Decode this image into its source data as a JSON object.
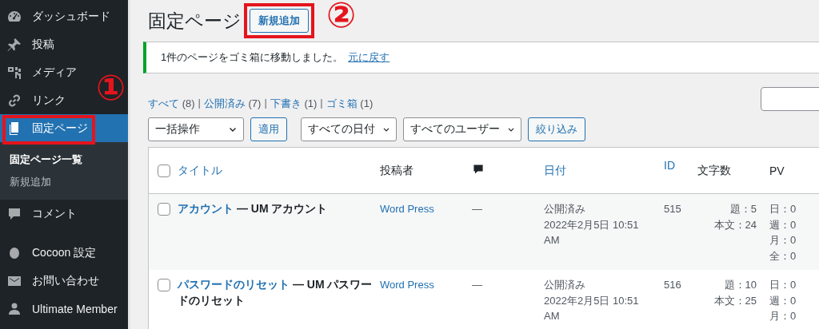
{
  "sidebar": {
    "menu_groups": [
      [
        {
          "kind": "dashboard",
          "label": "ダッシュボード",
          "selected": false,
          "highlighted": false
        },
        {
          "kind": "pin",
          "label": "投稿",
          "selected": false,
          "highlighted": false
        },
        {
          "kind": "media",
          "label": "メディア",
          "selected": false,
          "highlighted": false
        },
        {
          "kind": "link",
          "label": "リンク",
          "selected": false,
          "highlighted": false
        },
        {
          "kind": "pages",
          "label": "固定ページ",
          "selected": true,
          "highlighted": true,
          "callout": "①",
          "submenu": [
            {
              "label": "固定ページ一覧",
              "selected": true
            },
            {
              "label": "新規追加",
              "selected": false
            }
          ]
        },
        {
          "kind": "comment",
          "label": "コメント",
          "selected": false,
          "highlighted": false
        }
      ],
      [
        {
          "kind": "dot",
          "label": "Cocoon 設定",
          "selected": false,
          "highlighted": false
        },
        {
          "kind": "mail",
          "label": "お問い合わせ",
          "selected": false,
          "highlighted": false
        },
        {
          "kind": "user",
          "label": "Ultimate Member",
          "selected": false,
          "highlighted": false
        }
      ]
    ]
  },
  "page_header": {
    "title": "固定ページ",
    "add_new": {
      "label": "新規追加",
      "highlighted": true,
      "callout": "②"
    }
  },
  "notice": {
    "message": "1件のページをゴミ箱に移動しました。",
    "link": "元に戻す"
  },
  "views_separator": "|",
  "views": [
    {
      "label": "すべて",
      "count": "(8)"
    },
    {
      "label": "公開済み",
      "count": "(7)"
    },
    {
      "label": "下書き",
      "count": "(1)"
    },
    {
      "label": "ゴミ箱",
      "count": "(1)"
    }
  ],
  "toolbar": {
    "bulk_action": "一括操作",
    "apply": "適用",
    "date_filter": "すべての日付",
    "user_filter": "すべてのユーザー",
    "filter_button": "絞り込み"
  },
  "table": {
    "columns": [
      {
        "kind": "checkbox",
        "checked": false
      },
      {
        "kind": "text",
        "label": "タイトル",
        "sortable": true
      },
      {
        "kind": "text",
        "label": "投稿者",
        "sortable": false
      },
      {
        "kind": "comment-icon"
      },
      {
        "kind": "text",
        "label": "日付",
        "sortable": true
      },
      {
        "kind": "text",
        "label": "ID",
        "sortable": true
      },
      {
        "kind": "text",
        "label": "文字数",
        "sortable": false
      },
      {
        "kind": "text",
        "label": "PV",
        "sortable": false
      }
    ],
    "rows": [
      {
        "checked": false,
        "title": "アカウント",
        "post_state": "— UM アカウント",
        "author": "Word Press",
        "comments": "—",
        "status": "公開済み",
        "date": "2022年2月5日 10:51 AM",
        "id": "515",
        "char_count": [
          "題：5",
          "本文：24"
        ],
        "pv": [
          "日：0",
          "週：0",
          "月：0",
          "全：0"
        ]
      },
      {
        "checked": false,
        "title": "パスワードのリセット",
        "post_state": "— UM パスワードのリセット",
        "author": "Word Press",
        "comments": "—",
        "status": "公開済み",
        "date": "2022年2月5日 10:51 AM",
        "id": "516",
        "char_count": [
          "題：10",
          "本文：25"
        ],
        "pv": [
          "日：0",
          "週：0",
          "月：0"
        ]
      }
    ]
  }
}
